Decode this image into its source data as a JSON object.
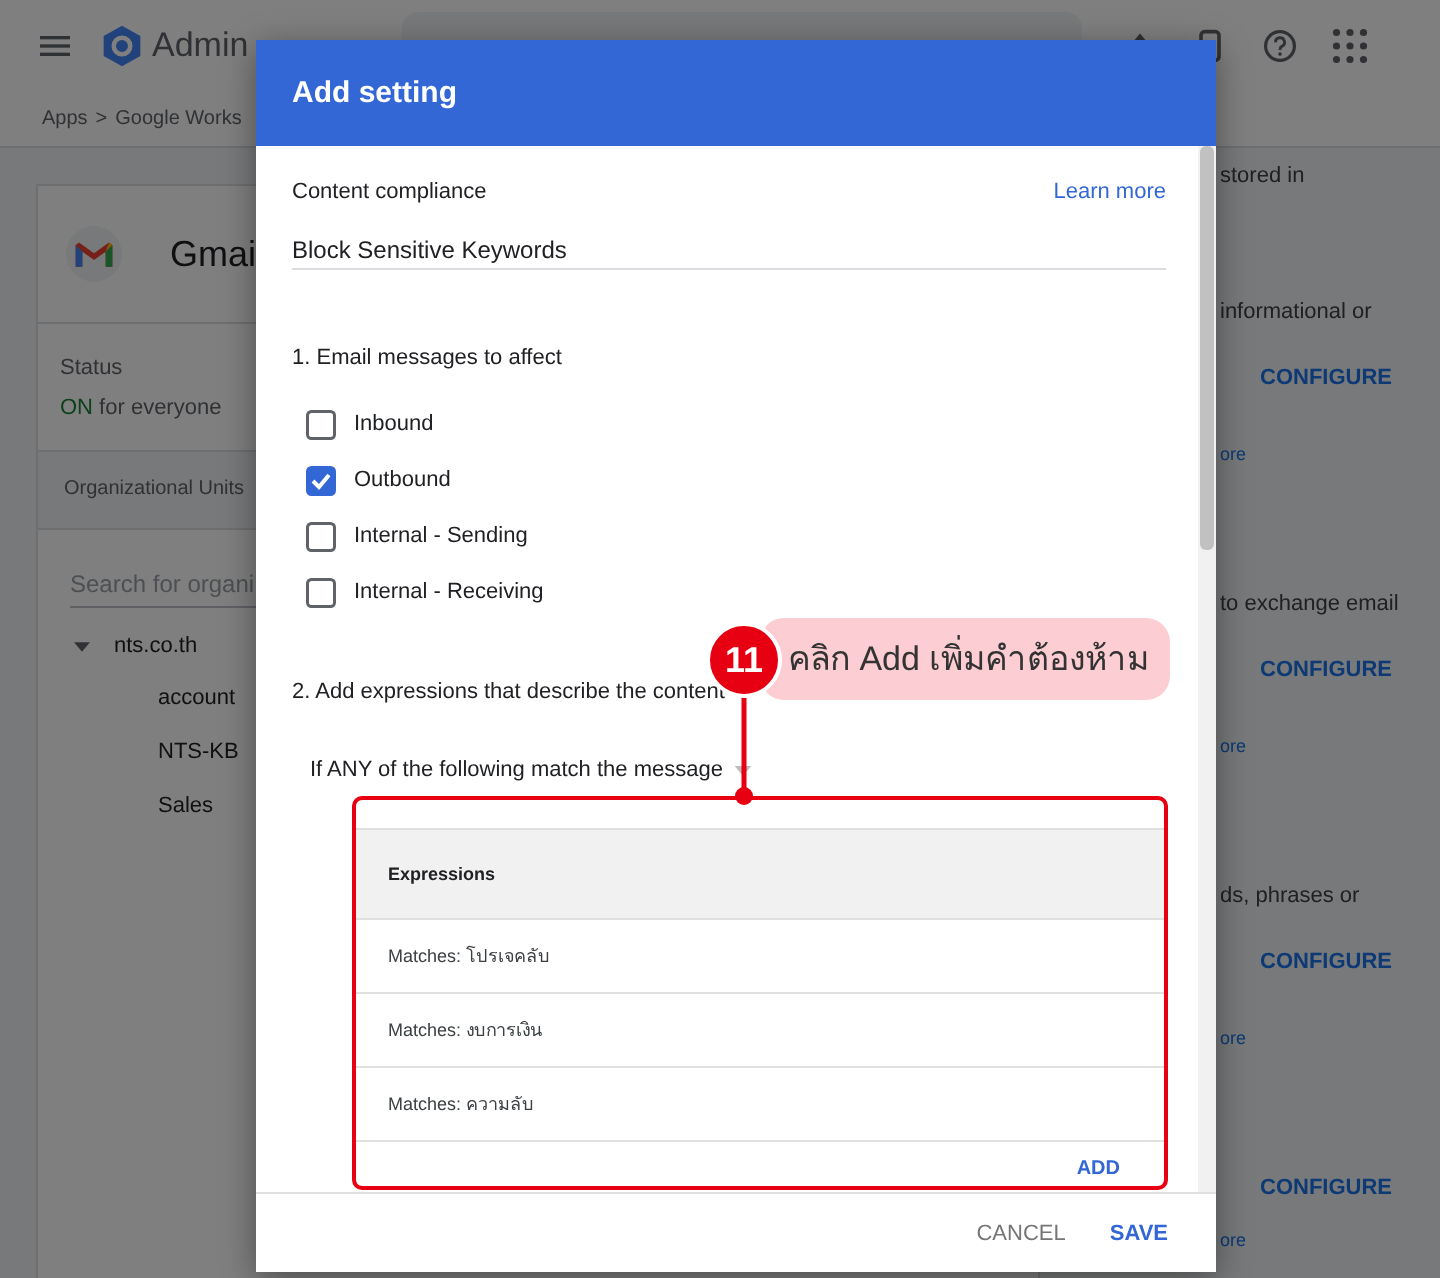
{
  "top_bar": {
    "product": "Admin"
  },
  "breadcrumb": [
    "Apps",
    ">",
    "Google Works"
  ],
  "app_card": {
    "name": "Gmai",
    "status_label": "Status",
    "status_state": "ON",
    "status_text": "for everyone"
  },
  "org_units": {
    "title": "Organizational Units",
    "search_placeholder": "Search for organi",
    "tree": [
      {
        "label": "nts.co.th",
        "expanded": true,
        "children": [
          {
            "label": "account"
          },
          {
            "label": "NTS-KB"
          },
          {
            "label": "Sales"
          }
        ]
      }
    ]
  },
  "settings": [
    {
      "description": "stored in"
    },
    {
      "description": "informational or",
      "action": "CONFIGURE",
      "link": "ore"
    },
    {
      "description": "to exchange email",
      "action": "CONFIGURE",
      "link": "ore"
    },
    {
      "description": "ds, phrases or",
      "action": "CONFIGURE",
      "link": "ore"
    },
    {
      "action": "CONFIGURE",
      "link": "ore"
    }
  ],
  "dialog": {
    "title": "Add setting",
    "section": "Content compliance",
    "learn_more": "Learn more",
    "name_value": "Block Sensitive Keywords",
    "step1": "1. Email messages to affect",
    "messages": [
      {
        "label": "Inbound",
        "checked": false
      },
      {
        "label": "Outbound",
        "checked": true
      },
      {
        "label": "Internal - Sending",
        "checked": false
      },
      {
        "label": "Internal - Receiving",
        "checked": false
      }
    ],
    "step2": "2. Add expressions that describe the content",
    "match_mode": "If ANY of the following match the message",
    "table": {
      "header": "Expressions",
      "rows": [
        "Matches: โปรเจคลับ",
        "Matches: งบการเงิน",
        "Matches: ความลับ"
      ],
      "add": "ADD"
    },
    "buttons": [
      {
        "label": "CANCEL",
        "primary": false
      },
      {
        "label": "SAVE",
        "primary": true
      }
    ]
  },
  "annotation": {
    "step": "11",
    "text": "คลิก Add เพิ่มคำต้องห้าม"
  }
}
